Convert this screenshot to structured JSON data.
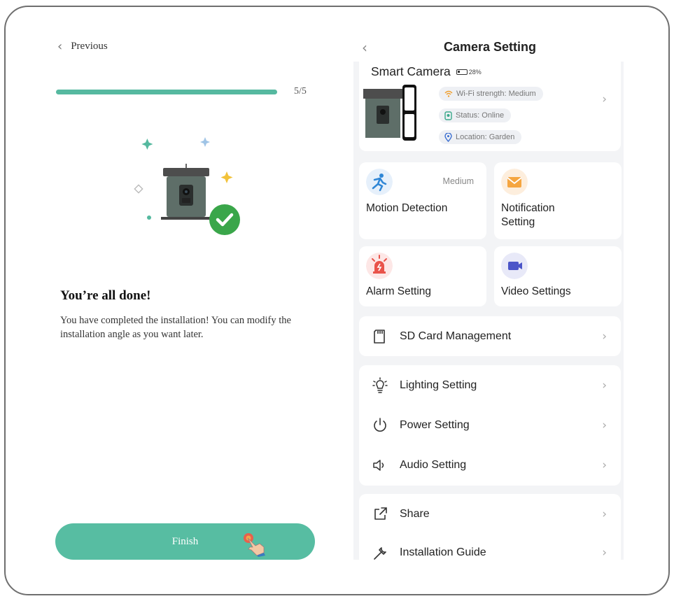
{
  "left": {
    "previous_label": "Previous",
    "progress": 1.0,
    "step_label": "5/5",
    "done_title": "You’re all done!",
    "done_body": "You have completed the installation! You can modify the installation angle as you want later.",
    "finish_label": "Finish"
  },
  "right": {
    "title": "Camera Setting",
    "camera": {
      "name": "Smart Camera",
      "battery": "28%",
      "wifi": "Wi-Fi strength: Medium",
      "status": "Status: Online",
      "location": "Location: Garden"
    },
    "tiles": [
      {
        "label": "Motion Detection",
        "value": "Medium",
        "icon": "running-person-icon",
        "color": "#e6f0fb"
      },
      {
        "label": "Notification Setting",
        "value": "",
        "icon": "envelope-icon",
        "color": "#fdeedd"
      },
      {
        "label": "Alarm Setting",
        "value": "",
        "icon": "alarm-siren-icon",
        "color": "#fde7e6"
      },
      {
        "label": "Video Settings",
        "value": "",
        "icon": "video-camera-icon",
        "color": "#e8e9f8"
      }
    ],
    "sd_card_label": "SD Card Management",
    "rows_group": [
      "Lighting Setting",
      "Power Setting",
      "Audio Setting"
    ],
    "rows_bottom": [
      "Share",
      "Installation Guide"
    ]
  },
  "colors": {
    "accent": "#57bda2",
    "check_green": "#3aa64a"
  }
}
